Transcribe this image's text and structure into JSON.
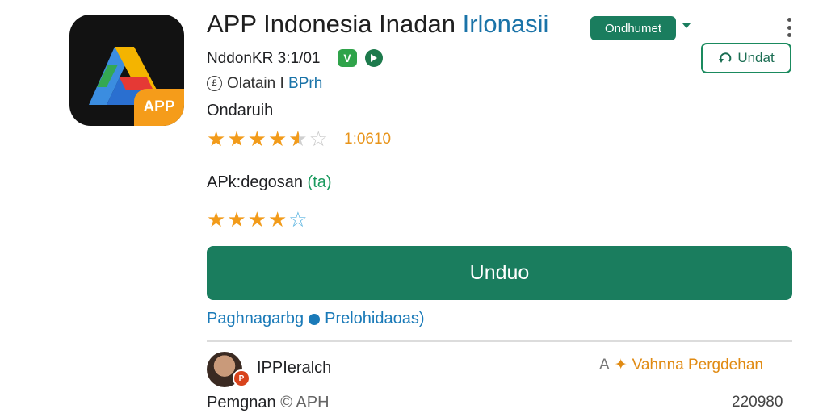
{
  "app": {
    "icon_badge": "APP",
    "title_main": "APP Indonesia Inadan",
    "title_accent": "Irlonasii",
    "version": "NddonKR 3:1/01",
    "version_badge": "V",
    "meta_symbol": "£",
    "meta_text": "Olatain",
    "meta_separator": "I",
    "meta_link": "BPrh",
    "developer": "Ondaruih",
    "rating_count": "1:0610"
  },
  "header": {
    "install_chip": "Ondhumet",
    "update_button": "Undat",
    "update_icon": "refresh-icon"
  },
  "apk": {
    "label": "APk:degosan",
    "label_accent": "(ta)"
  },
  "download_button": "Unduo",
  "links": {
    "first": "Paghnagarbg",
    "second": "Prelohidaoas)"
  },
  "review": {
    "reviewer": "IPPIeralch",
    "avatar_badge": "P",
    "tag_prefix": "A",
    "tag_icon": "star-icon",
    "tag_text": "Vahnna Pergdehan",
    "footer_label": "Pemgnan",
    "footer_symbol": "©",
    "footer_muted": "APH",
    "footer_number": "220980"
  },
  "ratings": {
    "stars_row1": 4.5,
    "stars_row2": 4
  },
  "colors": {
    "accent_green": "#1a7d5e",
    "star_orange": "#f29b1a",
    "link_blue": "#1a7ab8"
  }
}
